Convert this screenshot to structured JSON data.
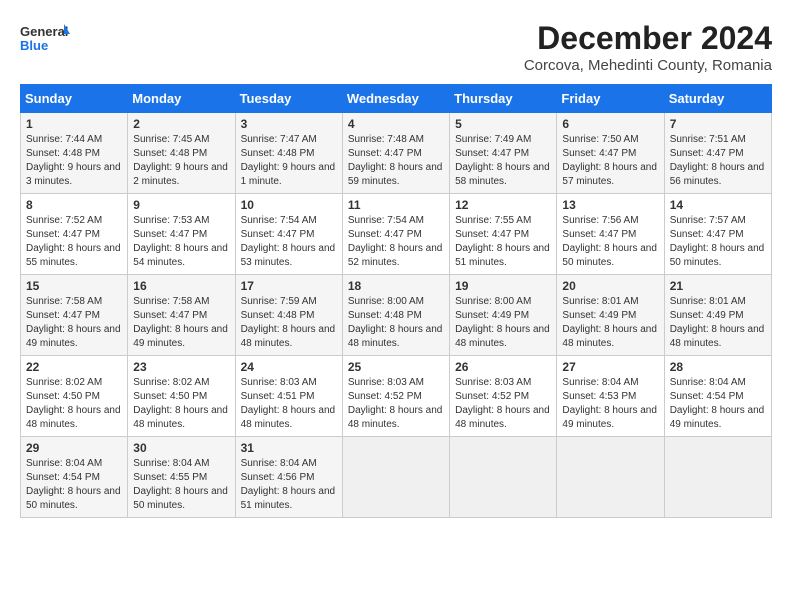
{
  "logo": {
    "line1": "General",
    "line2": "Blue"
  },
  "title": "December 2024",
  "subtitle": "Corcova, Mehedinti County, Romania",
  "days_of_week": [
    "Sunday",
    "Monday",
    "Tuesday",
    "Wednesday",
    "Thursday",
    "Friday",
    "Saturday"
  ],
  "weeks": [
    [
      {
        "day": "1",
        "sunrise": "Sunrise: 7:44 AM",
        "sunset": "Sunset: 4:48 PM",
        "daylight": "Daylight: 9 hours and 3 minutes."
      },
      {
        "day": "2",
        "sunrise": "Sunrise: 7:45 AM",
        "sunset": "Sunset: 4:48 PM",
        "daylight": "Daylight: 9 hours and 2 minutes."
      },
      {
        "day": "3",
        "sunrise": "Sunrise: 7:47 AM",
        "sunset": "Sunset: 4:48 PM",
        "daylight": "Daylight: 9 hours and 1 minute."
      },
      {
        "day": "4",
        "sunrise": "Sunrise: 7:48 AM",
        "sunset": "Sunset: 4:47 PM",
        "daylight": "Daylight: 8 hours and 59 minutes."
      },
      {
        "day": "5",
        "sunrise": "Sunrise: 7:49 AM",
        "sunset": "Sunset: 4:47 PM",
        "daylight": "Daylight: 8 hours and 58 minutes."
      },
      {
        "day": "6",
        "sunrise": "Sunrise: 7:50 AM",
        "sunset": "Sunset: 4:47 PM",
        "daylight": "Daylight: 8 hours and 57 minutes."
      },
      {
        "day": "7",
        "sunrise": "Sunrise: 7:51 AM",
        "sunset": "Sunset: 4:47 PM",
        "daylight": "Daylight: 8 hours and 56 minutes."
      }
    ],
    [
      {
        "day": "8",
        "sunrise": "Sunrise: 7:52 AM",
        "sunset": "Sunset: 4:47 PM",
        "daylight": "Daylight: 8 hours and 55 minutes."
      },
      {
        "day": "9",
        "sunrise": "Sunrise: 7:53 AM",
        "sunset": "Sunset: 4:47 PM",
        "daylight": "Daylight: 8 hours and 54 minutes."
      },
      {
        "day": "10",
        "sunrise": "Sunrise: 7:54 AM",
        "sunset": "Sunset: 4:47 PM",
        "daylight": "Daylight: 8 hours and 53 minutes."
      },
      {
        "day": "11",
        "sunrise": "Sunrise: 7:54 AM",
        "sunset": "Sunset: 4:47 PM",
        "daylight": "Daylight: 8 hours and 52 minutes."
      },
      {
        "day": "12",
        "sunrise": "Sunrise: 7:55 AM",
        "sunset": "Sunset: 4:47 PM",
        "daylight": "Daylight: 8 hours and 51 minutes."
      },
      {
        "day": "13",
        "sunrise": "Sunrise: 7:56 AM",
        "sunset": "Sunset: 4:47 PM",
        "daylight": "Daylight: 8 hours and 50 minutes."
      },
      {
        "day": "14",
        "sunrise": "Sunrise: 7:57 AM",
        "sunset": "Sunset: 4:47 PM",
        "daylight": "Daylight: 8 hours and 50 minutes."
      }
    ],
    [
      {
        "day": "15",
        "sunrise": "Sunrise: 7:58 AM",
        "sunset": "Sunset: 4:47 PM",
        "daylight": "Daylight: 8 hours and 49 minutes."
      },
      {
        "day": "16",
        "sunrise": "Sunrise: 7:58 AM",
        "sunset": "Sunset: 4:47 PM",
        "daylight": "Daylight: 8 hours and 49 minutes."
      },
      {
        "day": "17",
        "sunrise": "Sunrise: 7:59 AM",
        "sunset": "Sunset: 4:48 PM",
        "daylight": "Daylight: 8 hours and 48 minutes."
      },
      {
        "day": "18",
        "sunrise": "Sunrise: 8:00 AM",
        "sunset": "Sunset: 4:48 PM",
        "daylight": "Daylight: 8 hours and 48 minutes."
      },
      {
        "day": "19",
        "sunrise": "Sunrise: 8:00 AM",
        "sunset": "Sunset: 4:49 PM",
        "daylight": "Daylight: 8 hours and 48 minutes."
      },
      {
        "day": "20",
        "sunrise": "Sunrise: 8:01 AM",
        "sunset": "Sunset: 4:49 PM",
        "daylight": "Daylight: 8 hours and 48 minutes."
      },
      {
        "day": "21",
        "sunrise": "Sunrise: 8:01 AM",
        "sunset": "Sunset: 4:49 PM",
        "daylight": "Daylight: 8 hours and 48 minutes."
      }
    ],
    [
      {
        "day": "22",
        "sunrise": "Sunrise: 8:02 AM",
        "sunset": "Sunset: 4:50 PM",
        "daylight": "Daylight: 8 hours and 48 minutes."
      },
      {
        "day": "23",
        "sunrise": "Sunrise: 8:02 AM",
        "sunset": "Sunset: 4:50 PM",
        "daylight": "Daylight: 8 hours and 48 minutes."
      },
      {
        "day": "24",
        "sunrise": "Sunrise: 8:03 AM",
        "sunset": "Sunset: 4:51 PM",
        "daylight": "Daylight: 8 hours and 48 minutes."
      },
      {
        "day": "25",
        "sunrise": "Sunrise: 8:03 AM",
        "sunset": "Sunset: 4:52 PM",
        "daylight": "Daylight: 8 hours and 48 minutes."
      },
      {
        "day": "26",
        "sunrise": "Sunrise: 8:03 AM",
        "sunset": "Sunset: 4:52 PM",
        "daylight": "Daylight: 8 hours and 48 minutes."
      },
      {
        "day": "27",
        "sunrise": "Sunrise: 8:04 AM",
        "sunset": "Sunset: 4:53 PM",
        "daylight": "Daylight: 8 hours and 49 minutes."
      },
      {
        "day": "28",
        "sunrise": "Sunrise: 8:04 AM",
        "sunset": "Sunset: 4:54 PM",
        "daylight": "Daylight: 8 hours and 49 minutes."
      }
    ],
    [
      {
        "day": "29",
        "sunrise": "Sunrise: 8:04 AM",
        "sunset": "Sunset: 4:54 PM",
        "daylight": "Daylight: 8 hours and 50 minutes."
      },
      {
        "day": "30",
        "sunrise": "Sunrise: 8:04 AM",
        "sunset": "Sunset: 4:55 PM",
        "daylight": "Daylight: 8 hours and 50 minutes."
      },
      {
        "day": "31",
        "sunrise": "Sunrise: 8:04 AM",
        "sunset": "Sunset: 4:56 PM",
        "daylight": "Daylight: 8 hours and 51 minutes."
      },
      {
        "day": "",
        "sunrise": "",
        "sunset": "",
        "daylight": ""
      },
      {
        "day": "",
        "sunrise": "",
        "sunset": "",
        "daylight": ""
      },
      {
        "day": "",
        "sunrise": "",
        "sunset": "",
        "daylight": ""
      },
      {
        "day": "",
        "sunrise": "",
        "sunset": "",
        "daylight": ""
      }
    ]
  ]
}
